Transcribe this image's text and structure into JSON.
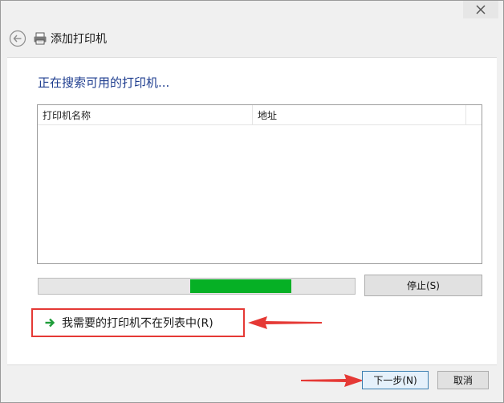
{
  "window": {
    "title": "添加打印机"
  },
  "page": {
    "heading": "正在搜索可用的打印机..."
  },
  "table": {
    "columns": [
      "打印机名称",
      "地址"
    ]
  },
  "progress": {
    "fill_start_fraction": 0.48,
    "fill_end_fraction": 0.8
  },
  "buttons": {
    "stop": "停止(S)",
    "next": "下一步(N)",
    "cancel": "取消"
  },
  "link": {
    "text": "我需要的打印机不在列表中(R)"
  },
  "icons": {
    "close": "close-icon",
    "back": "back-arrow-icon",
    "printer": "printer-icon",
    "link_arrow": "green-arrow-icon"
  },
  "colors": {
    "heading": "#1e3d8f",
    "progress_fill": "#06b025",
    "annotation": "#e53935"
  }
}
